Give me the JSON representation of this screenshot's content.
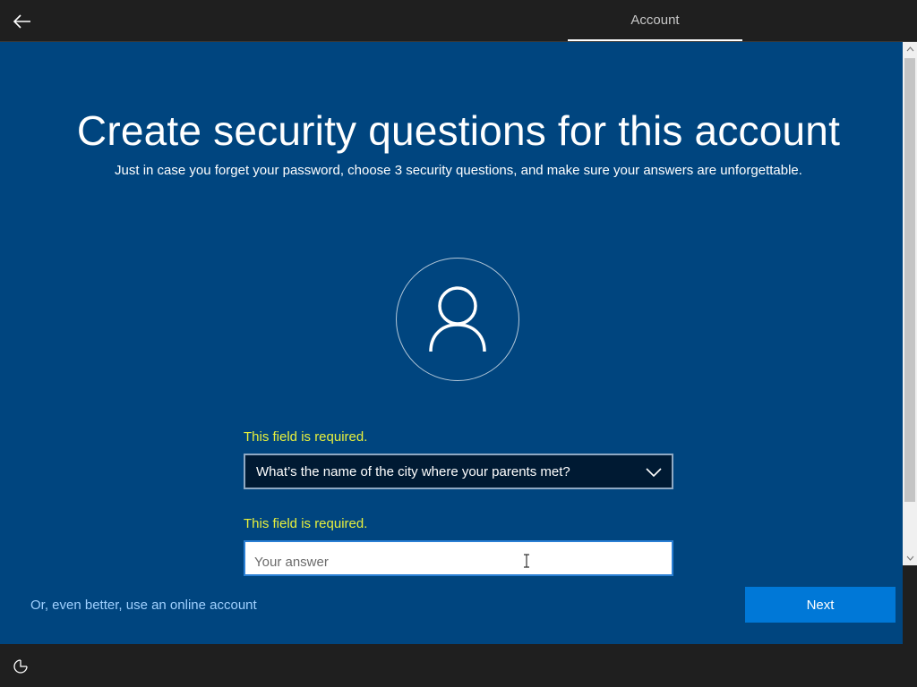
{
  "header": {
    "back_icon": "back-arrow-icon",
    "tab_label": "Account"
  },
  "content": {
    "title": "Create security questions for this account",
    "subtitle": "Just in case you forget your password, choose 3 security questions, and make sure your answers are unforgettable.",
    "avatar_icon": "user-icon",
    "question": {
      "error": "This field is required.",
      "selected": "What’s the name of the city where your parents met?"
    },
    "answer": {
      "error": "This field is required.",
      "placeholder": "Your answer",
      "value": ""
    }
  },
  "footer": {
    "online_link": "Or, even better, use an online account",
    "next_label": "Next"
  },
  "bottom": {
    "ease_icon": "ease-of-access-icon"
  },
  "colors": {
    "background": "#00457f",
    "accent": "#0078d7",
    "error": "#e8f03c",
    "link": "#9fd0ff"
  }
}
